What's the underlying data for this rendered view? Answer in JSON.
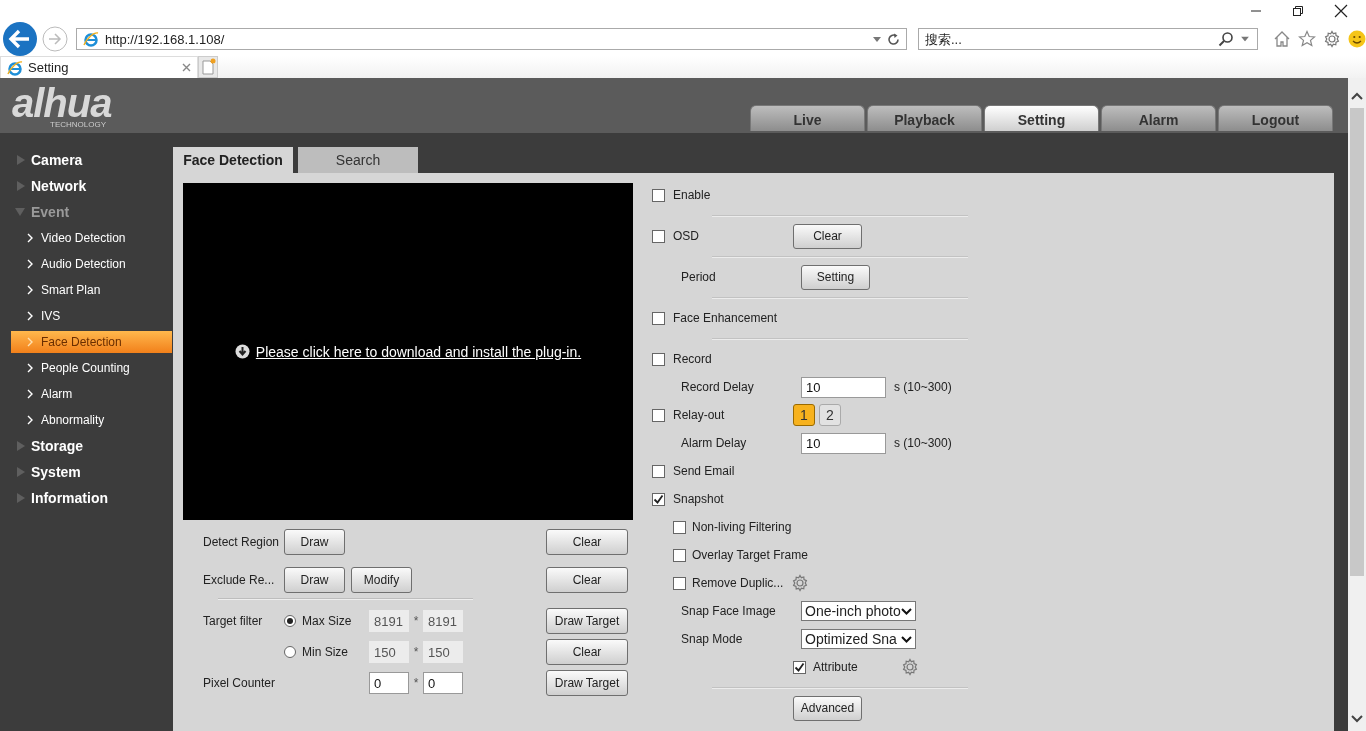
{
  "browser": {
    "url": "http://192.168.1.108/",
    "search_placeholder": "搜索...",
    "tab_title": "Setting"
  },
  "header": {
    "logo": "alhua",
    "logo_tagline": "TECHNOLOGY",
    "nav_tabs": [
      {
        "label": "Live",
        "selected": false
      },
      {
        "label": "Playback",
        "selected": false
      },
      {
        "label": "Setting",
        "selected": true
      },
      {
        "label": "Alarm",
        "selected": false
      },
      {
        "label": "Logout",
        "selected": false
      }
    ]
  },
  "sidebar": {
    "items": [
      {
        "label": "Camera",
        "expanded": false
      },
      {
        "label": "Network",
        "expanded": false
      },
      {
        "label": "Event",
        "expanded": true,
        "children": [
          {
            "label": "Video Detection",
            "selected": false
          },
          {
            "label": "Audio Detection",
            "selected": false
          },
          {
            "label": "Smart Plan",
            "selected": false
          },
          {
            "label": "IVS",
            "selected": false
          },
          {
            "label": "Face Detection",
            "selected": true
          },
          {
            "label": "People Counting",
            "selected": false
          },
          {
            "label": "Alarm",
            "selected": false
          },
          {
            "label": "Abnormality",
            "selected": false
          }
        ]
      },
      {
        "label": "Storage",
        "expanded": false
      },
      {
        "label": "System",
        "expanded": false
      },
      {
        "label": "Information",
        "expanded": false
      }
    ]
  },
  "page_tabs": [
    {
      "label": "Face Detection",
      "selected": true
    },
    {
      "label": "Search",
      "selected": false
    }
  ],
  "video": {
    "message": "Please click here to download and install the plug-in."
  },
  "region_rows": [
    {
      "kind": "buttons",
      "label": "Detect Region",
      "buttons": [
        "Draw"
      ],
      "action": "Clear",
      "separator": false
    },
    {
      "kind": "buttons",
      "label": "Exclude Re...",
      "buttons": [
        "Draw",
        "Modify"
      ],
      "action": "Clear",
      "separator": true
    },
    {
      "kind": "size",
      "label": "Target filter",
      "option": {
        "label": "Max Size",
        "selected": true
      },
      "inputs": [
        {
          "value": "8191",
          "disabled": true
        },
        {
          "value": "8191",
          "disabled": true
        }
      ],
      "joiner": "*",
      "action": "Draw Target"
    },
    {
      "kind": "size",
      "option": {
        "label": "Min Size",
        "selected": false
      },
      "inputs": [
        {
          "value": "150",
          "disabled": true
        },
        {
          "value": "150",
          "disabled": true
        }
      ],
      "joiner": "*",
      "action": "Clear"
    },
    {
      "kind": "size",
      "label": "Pixel Counter",
      "inputs": [
        {
          "value": "0",
          "disabled": false
        },
        {
          "value": "0",
          "disabled": false
        }
      ],
      "joiner": "*",
      "action": "Draw Target"
    }
  ],
  "settings": [
    {
      "kind": "check",
      "label": "Enable",
      "checked": false,
      "separator": true
    },
    {
      "kind": "check",
      "label": "OSD",
      "checked": false,
      "button": "Clear",
      "separator": true
    },
    {
      "kind": "field",
      "label": "Period",
      "button": "Setting",
      "separator": true
    },
    {
      "kind": "check",
      "label": "Face Enhancement",
      "checked": false,
      "separator": true
    },
    {
      "kind": "check",
      "label": "Record",
      "checked": false
    },
    {
      "kind": "field",
      "label": "Record Delay",
      "input": "10",
      "unit": "s (10~300)"
    },
    {
      "kind": "check",
      "label": "Relay-out",
      "checked": false,
      "relays": [
        {
          "label": "1",
          "selected": true
        },
        {
          "label": "2",
          "selected": false
        }
      ]
    },
    {
      "kind": "field",
      "label": "Alarm Delay",
      "input": "10",
      "unit": "s (10~300)"
    },
    {
      "kind": "check",
      "label": "Send Email",
      "checked": false
    },
    {
      "kind": "check",
      "label": "Snapshot",
      "checked": true
    },
    {
      "kind": "subcheck",
      "label": "Non-living Filtering",
      "checked": false
    },
    {
      "kind": "subcheck",
      "label": "Overlay Target Frame",
      "checked": false
    },
    {
      "kind": "subcheck",
      "label": "Remove Duplic...",
      "checked": false,
      "gear": true
    },
    {
      "kind": "select",
      "label": "Snap Face Image",
      "value": "One-inch photo"
    },
    {
      "kind": "select",
      "label": "Snap Mode",
      "value": "Optimized Sna"
    },
    {
      "kind": "inline-check",
      "label": "Attribute",
      "checked": true,
      "gear": true,
      "separator": true
    },
    {
      "kind": "action",
      "button": "Advanced"
    }
  ]
}
